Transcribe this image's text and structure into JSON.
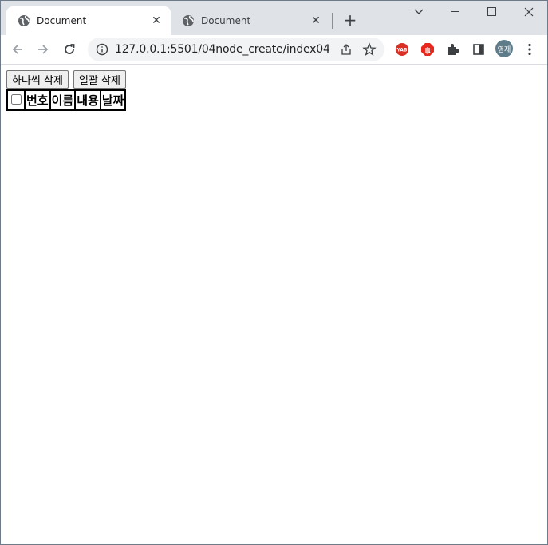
{
  "tabs": [
    {
      "title": "Document",
      "active": true
    },
    {
      "title": "Document",
      "active": false
    }
  ],
  "address_bar": {
    "url": "127.0.0.1:5501/04node_create/index04(..."
  },
  "extensions": {
    "avatar_label": "영재"
  },
  "page": {
    "buttons": {
      "delete_one": "하나씩 삭제",
      "delete_all": "일괄 삭제"
    },
    "table": {
      "headers": [
        "번호",
        "이름",
        "내용",
        "날짜"
      ]
    }
  },
  "colors": {
    "tabstrip": "#dfe3e8",
    "omnibox": "#f1f3f4",
    "avatar": "#5f7c8a"
  }
}
